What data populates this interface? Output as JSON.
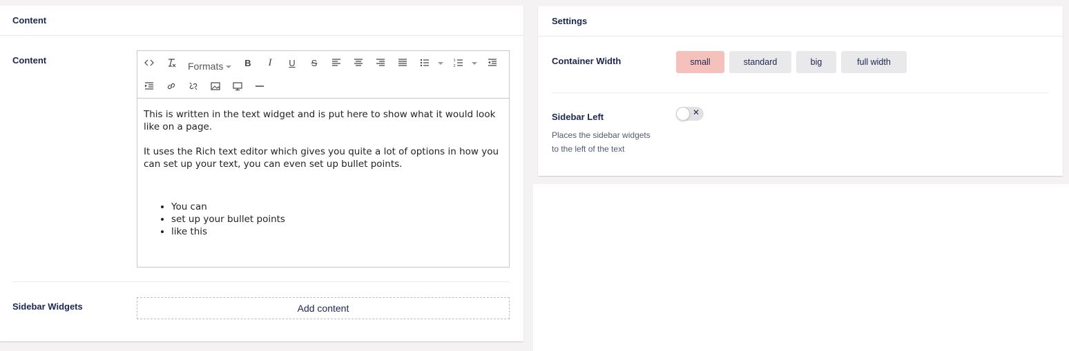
{
  "content_panel": {
    "title": "Content",
    "content_label": "Content",
    "sidebar_widgets_label": "Sidebar Widgets",
    "add_content_label": "Add content"
  },
  "editor": {
    "formats_label": "Formats",
    "toolbar_icons": [
      "code-icon",
      "clear-formatting-icon",
      "bold-icon",
      "italic-icon",
      "underline-icon",
      "strikethrough-icon",
      "align-left-icon",
      "align-center-icon",
      "align-right-icon",
      "justify-icon",
      "bullet-list-icon",
      "numbered-list-icon",
      "outdent-icon",
      "indent-icon",
      "link-icon",
      "unlink-icon",
      "image-icon",
      "media-icon",
      "horizontal-rule-icon"
    ],
    "paragraphs": [
      "This is written in the text widget and is put here to show what it would look like on a page.",
      "It uses the Rich text editor which gives you quite a lot of options in how you can set up your text, you can even set up bullet points."
    ],
    "bullets": [
      "You can",
      "set up your bullet points",
      "like this"
    ]
  },
  "settings_panel": {
    "title": "Settings",
    "container_width_label": "Container Width",
    "width_options": [
      "small",
      "standard",
      "big",
      "full width"
    ],
    "selected_width": "small",
    "sidebar_left_label": "Sidebar Left",
    "sidebar_left_desc_line1": "Places the sidebar widgets",
    "sidebar_left_desc_line2": "to the left of the text",
    "sidebar_left_enabled": false,
    "toggle_off_glyph": "✕"
  },
  "colors": {
    "text": "#1b264f",
    "active_option": "#f5c1bd",
    "option": "#e9e9eb",
    "page_bg": "#f4f2f3"
  }
}
